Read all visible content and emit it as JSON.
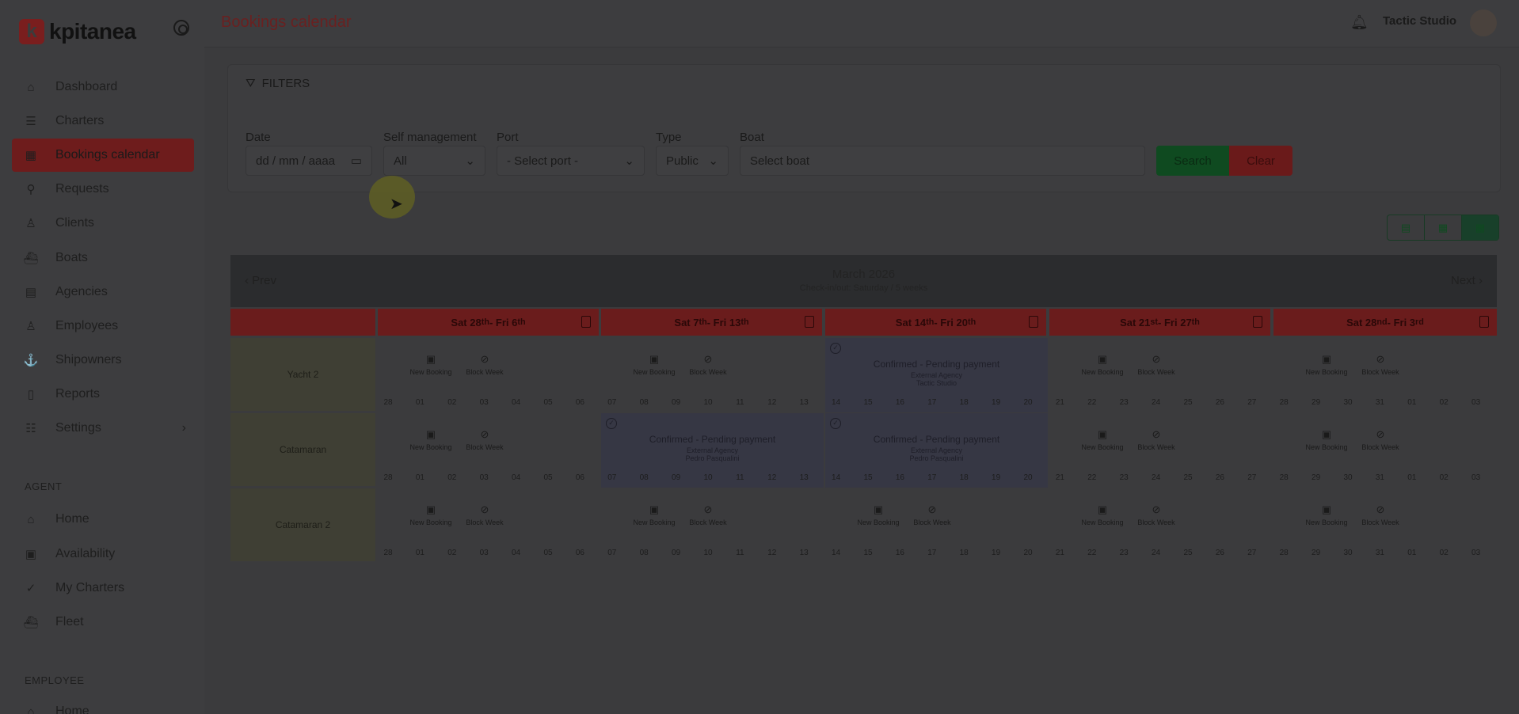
{
  "brand": {
    "logo_letter": "k",
    "name": "kpitanea"
  },
  "sidebar": {
    "main": [
      {
        "label": "Dashboard",
        "icon": "⌂"
      },
      {
        "label": "Charters",
        "icon": "☰"
      },
      {
        "label": "Bookings calendar",
        "icon": "▦"
      },
      {
        "label": "Requests",
        "icon": "⚲"
      },
      {
        "label": "Clients",
        "icon": "♙"
      },
      {
        "label": "Boats",
        "icon": "⛴"
      },
      {
        "label": "Agencies",
        "icon": "▤"
      },
      {
        "label": "Employees",
        "icon": "♙"
      },
      {
        "label": "Shipowners",
        "icon": "⚓"
      },
      {
        "label": "Reports",
        "icon": "▯"
      },
      {
        "label": "Settings",
        "icon": "☷"
      }
    ],
    "agent_label": "AGENT",
    "agent": [
      {
        "label": "Home",
        "icon": "⌂"
      },
      {
        "label": "Availability",
        "icon": "▣"
      },
      {
        "label": "My Charters",
        "icon": "✓"
      },
      {
        "label": "Fleet",
        "icon": "⛴"
      }
    ],
    "employee_label": "EMPLOYEE",
    "employee": [
      {
        "label": "Home",
        "icon": "⌂"
      }
    ]
  },
  "header": {
    "title": "Bookings calendar",
    "user": "Tactic Studio"
  },
  "filters": {
    "title": "FILTERS",
    "date_label": "Date",
    "date_placeholder": "dd / mm / aaaa",
    "self_label": "Self management",
    "self_value": "All",
    "port_label": "Port",
    "port_value": "- Select port -",
    "type_label": "Type",
    "type_value": "Public",
    "boat_label": "Boat",
    "boat_value": "Select boat",
    "search_label": "Search",
    "clear_label": "Clear"
  },
  "calendar": {
    "prev": "Prev",
    "next": "Next",
    "month": "March 2026",
    "subtitle": "Check-in/out: Saturday / 5 weeks",
    "weeks": [
      {
        "a": "Sat 28",
        "a_sup": "th",
        "b": " - Fri 6",
        "b_sup": "th"
      },
      {
        "a": "Sat 7",
        "a_sup": "th",
        "b": " - Fri 13",
        "b_sup": "th"
      },
      {
        "a": "Sat 14",
        "a_sup": "th",
        "b": " - Fri 20",
        "b_sup": "th"
      },
      {
        "a": "Sat 21",
        "a_sup": "st",
        "b": " - Fri 27",
        "b_sup": "th"
      },
      {
        "a": "Sat 28",
        "a_sup": "nd",
        "b": " - Fri 3",
        "b_sup": "rd"
      }
    ],
    "new_booking": "New Booking",
    "block_week": "Block Week",
    "boats": [
      "Yacht 2",
      "Catamaran",
      "Catamaran 2"
    ],
    "days": [
      "28",
      "01",
      "02",
      "03",
      "04",
      "05",
      "06",
      "07",
      "08",
      "09",
      "10",
      "11",
      "12",
      "13",
      "14",
      "15",
      "16",
      "17",
      "18",
      "19",
      "20",
      "21",
      "22",
      "23",
      "24",
      "25",
      "26",
      "27",
      "28",
      "29",
      "30",
      "31",
      "01",
      "02",
      "03"
    ],
    "bookings": [
      {
        "title": "Confirmed - Pending payment",
        "agency": "External Agency",
        "person": "Tactic Studio"
      },
      {
        "title": "Confirmed - Pending payment",
        "agency": "External Agency",
        "person": "Pedro Pasqualini"
      },
      {
        "title": "Confirmed - Pending payment",
        "agency": "External Agency",
        "person": "Pedro Pasqualini"
      }
    ]
  }
}
